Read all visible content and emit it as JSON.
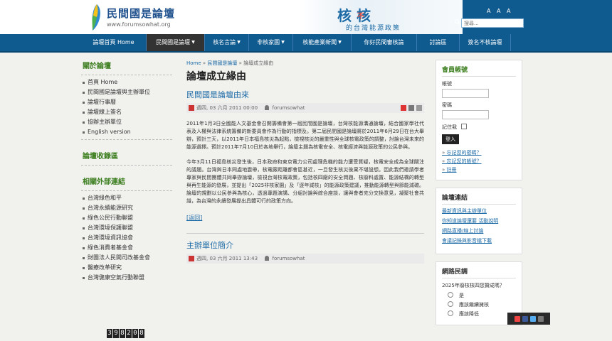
{
  "header": {
    "site_title": "民間國是論壇",
    "site_url": "www.forumsowhat.org",
    "banner_title": "核 核",
    "banner_mark": "不",
    "banner_subtitle": "的台灣能源政策",
    "font_size_ctl": "A A A",
    "search_placeholder": "搜尋...",
    "colors": {
      "nav": "#0f5a8f",
      "active_nav": "#333333",
      "green_heading": "#3a7d1c",
      "link": "#1c6aa6"
    }
  },
  "nav": {
    "items": [
      {
        "label": "論壇首頁 Home",
        "dropdown": false
      },
      {
        "label": "民間國是論壇",
        "dropdown": true,
        "active": true
      },
      {
        "label": "核名言論",
        "dropdown": true
      },
      {
        "label": "非核家園",
        "dropdown": true
      },
      {
        "label": "核能產業新聞",
        "dropdown": true
      },
      {
        "label": "你好民間審核論",
        "dropdown": false
      },
      {
        "label": "討論區",
        "dropdown": false
      },
      {
        "label": "簽名不核論壇",
        "dropdown": false
      }
    ]
  },
  "left": {
    "about_title": "關於論壇",
    "about_items": [
      "首頁 Home",
      "民間國是論壇與主辦單位",
      "論壇行事曆",
      "論壇線上簽名",
      "協辦主辦單位",
      "English version"
    ],
    "collect_title": "論壇收錄區",
    "links_title": "相關外部連結",
    "link_items": [
      "台灣綠色和平",
      "台灣永續能源研究",
      "綠色公民行動聯盟",
      "台灣環境保護聯盟",
      "台灣環境資訊協會",
      "綠色消費者基金會",
      "財團法人民間司改基金會",
      "醫療改革研究",
      "台灣健康空氣行動聯盟"
    ],
    "counter": "398208"
  },
  "main": {
    "breadcrumb": {
      "home": "Home",
      "sep": "»",
      "mid": "民間國是論壇",
      "current": "論壇成立緣由"
    },
    "page_title": "論壇成立緣由",
    "article1": {
      "title": "民間國是論壇由來",
      "meta_date": "週四, 03 六月 2011 00:00",
      "meta_author": "forumsowhat",
      "p1": "2011年1月3日全國能人文基金會召開籌備會第一屆民間國是論壇，台灣核能源溝通論壇，結合國家學社代表及人權與法律系統籌備的新委員會作為行動的指標及。第二屆民間國是論壇將於2011年6月29日在台大舉辦，預計三天，以2011年日本福島核災為起點，檢視核災的嚴重性與全球核電政策的調整，討論台灣未來的能源選擇。預計2011年7月10日於各地舉行，論壇主題為核電安全、核電經濟與能源政策的公民參與。",
      "p2": "今年3月11日福島核災發生後，日本政府和東京電力公司處理危機的能力遭受質疑，核電安全成為全球關注的議題。台灣與日本同處地震帶，核電廠距離都會區甚近，一旦發生核災後果不堪設想。因此我們邀請學者專家與民間團體共同舉辦論壇，檢視台灣核電政策，包括核四廠的安全問題、核廢料處置、能源結構的轉型與再生能源的發展，並提出「2025非核家園」及「逐年減核」的能源政策建議，推動能源轉型與節能減碳。論壇的規劃以公民參與為核心，透過專題演講、分組討論與綜合座談，讓與會者充分交換意見，凝聚社會共識，為台灣的永續發展提出具體可行的政策方向。"
    },
    "back_link": "[返回]",
    "article2": {
      "title": "主辦單位簡介",
      "meta_date": "週四, 03 六月 2011 13:43",
      "meta_author": "forumsowhat"
    }
  },
  "right": {
    "login": {
      "title": "會員帳號",
      "user_label": "帳號",
      "pass_label": "密碼",
      "remember_label": "記住我",
      "login_button": "登入",
      "links": [
        "忘記您的密碼？",
        "忘記您的帳號？",
        "註冊"
      ]
    },
    "forum_links": {
      "title": "論壇連結",
      "items": [
        "最新資訊與主辦單位",
        "你知道論壇還要 活動說明",
        "網路直播/線上討論",
        "會議記錄與影音檔下載"
      ]
    },
    "poll": {
      "title": "網路民調",
      "question": "2025年廢核核四您贊成嗎？",
      "options": [
        "是",
        "應該繼續擁核",
        "應該降低"
      ]
    }
  }
}
